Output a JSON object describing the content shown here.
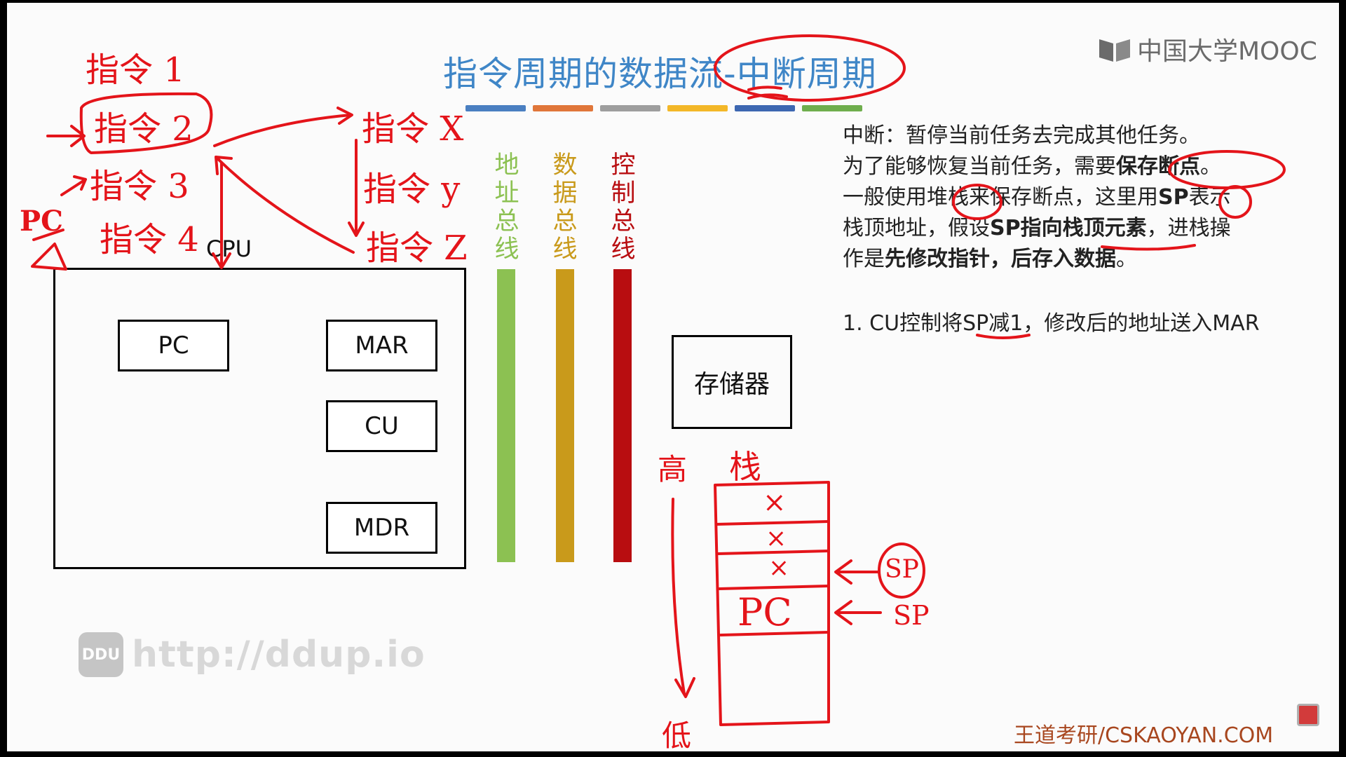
{
  "slide": {
    "title_prefix": "指令周期的数据流-",
    "title_highlight": "中断周期",
    "logo_text": "中国大学MOOC",
    "accent_colors": [
      "#4a7fc1",
      "#e0763a",
      "#9e9e9e",
      "#f3b728",
      "#3d67b1",
      "#6fae4d"
    ]
  },
  "explanation": {
    "line1": "中断：暂停当前任务去完成其他任务。",
    "line2_a": "为了能够恢复当前任务，需要",
    "line2_b": "保存断点",
    "line2_c": "。",
    "line3_a": "一般使用",
    "line3_b": "堆栈",
    "line3_c": "来保存断点，这里用",
    "line3_d": "SP",
    "line3_e": "表示",
    "line4_a": "栈顶地址，假设",
    "line4_b": "SP指向栈顶元素",
    "line4_c": "，进栈操",
    "line5_a": "作是",
    "line5_b": "先修改指针，后存入数据",
    "line5_c": "。",
    "step1": "1. CU控制将SP减1，修改后的地址送入MAR"
  },
  "cpu": {
    "label": "CPU",
    "registers": {
      "pc": "PC",
      "mar": "MAR",
      "cu": "CU",
      "mdr": "MDR"
    }
  },
  "buses": {
    "address": {
      "label": "地址总线",
      "color": "#8cc152"
    },
    "data": {
      "label": "数据总线",
      "color": "#c99a1b"
    },
    "control": {
      "label": "控制总线",
      "color": "#b80d10"
    }
  },
  "memory": {
    "label": "存储器"
  },
  "annotations": {
    "instr1": "指令 1",
    "instr2": "指令 2",
    "instr3": "指令 3",
    "instr4": "指令 4",
    "instrX": "指令 X",
    "instrY": "指令 y",
    "instrZ": "指令 Z",
    "pc_mark": "PC",
    "high": "高",
    "low": "低",
    "stack_head": "栈",
    "stack_cells": [
      "×",
      "×",
      "×",
      "PC"
    ],
    "sp_circle": "SP",
    "sp_plain": "SP"
  },
  "watermark": {
    "badge": "DDU",
    "url": "http://ddup.io"
  },
  "footer": "王道考研/CSKAOYAN.COM"
}
